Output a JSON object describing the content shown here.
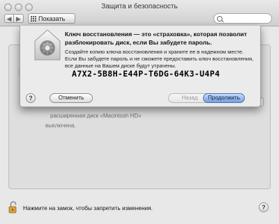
{
  "window": {
    "title": "Защита и безопасность",
    "show_all_label": "Показать все",
    "search_placeholder": ""
  },
  "background": {
    "text_1": "расширенная диск «Macintosh HD»",
    "text_2": "выключена."
  },
  "sheet": {
    "title": "Ключ восстановления — это «страховка», которая позволит разблокировать диск, если Вы забудете пароль.",
    "body": "Создайте копию ключа восстановления и храните ее в надежном месте. Если Вы забудете пароль и не сможете предоставить ключ восстановления, все данные на Вашем диске будут утрачены.",
    "recovery_key": "A7X2-5B8H-E44P-T6DG-64K3-U4P4",
    "help_label": "?",
    "cancel_label": "Отменить",
    "back_label": "Назад",
    "continue_label": "Продолжить"
  },
  "footer": {
    "lock_label": "Нажмите на замок, чтобы запретить изменения.",
    "help_label": "?"
  },
  "colors": {
    "default_button": "#6fa1e3",
    "window_bg": "#e8e8e8"
  },
  "icons": [
    "close-icon",
    "minimize-icon",
    "zoom-icon",
    "back-arrow-icon",
    "forward-arrow-icon",
    "grid-icon",
    "search-icon",
    "filevault-lock-icon",
    "padlock-open-icon"
  ]
}
